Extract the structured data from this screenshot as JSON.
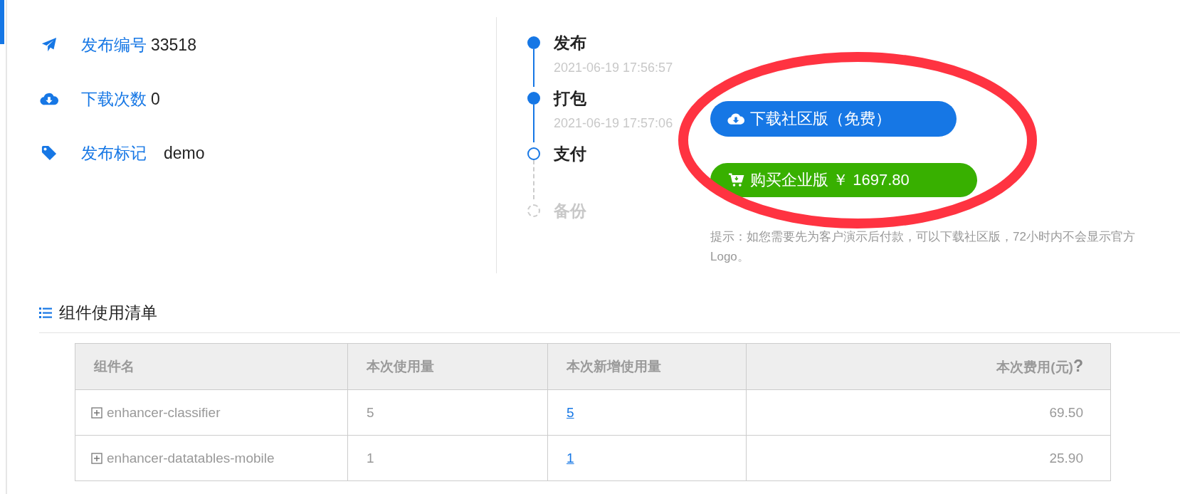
{
  "stats": [
    {
      "kind": "release",
      "label": "发布编号",
      "value": "33518"
    },
    {
      "kind": "downloads",
      "label": "下载次数",
      "value": "0"
    },
    {
      "kind": "tag",
      "label": "发布标记",
      "value": "demo"
    }
  ],
  "timeline": [
    {
      "title": "发布",
      "time": "2021-06-19 17:56:57",
      "completed": true,
      "active": false
    },
    {
      "title": "打包",
      "time": "2021-06-19 17:57:06",
      "completed": true,
      "active": false
    },
    {
      "title": "支付",
      "completed": false,
      "active": true
    },
    {
      "title": "备份",
      "completed": false,
      "active": false
    }
  ],
  "actions": [
    {
      "kind": "download",
      "label": "下载社区版（免费）"
    },
    {
      "kind": "buy",
      "label": "购买企业版 ￥ 1697.80"
    }
  ],
  "hint": "提示：如您需要先为客户演示后付款，可以下载社区版，72小时内不会显示官方 Logo。",
  "annotation": {
    "kind": "ellipse"
  },
  "section": {
    "title": "组件使用清单"
  },
  "table": {
    "columns": [
      {
        "label": "组件名"
      },
      {
        "label": "本次使用量"
      },
      {
        "label": "本次新增使用量"
      },
      {
        "label": "本次费用(元)",
        "help": "?"
      }
    ],
    "rows": [
      {
        "name": "enhancer-classifier",
        "usage": "5",
        "new_usage": "5",
        "cost": "69.50"
      },
      {
        "name": "enhancer-datatables-mobile",
        "usage": "1",
        "new_usage": "1",
        "cost": "25.90"
      }
    ]
  }
}
